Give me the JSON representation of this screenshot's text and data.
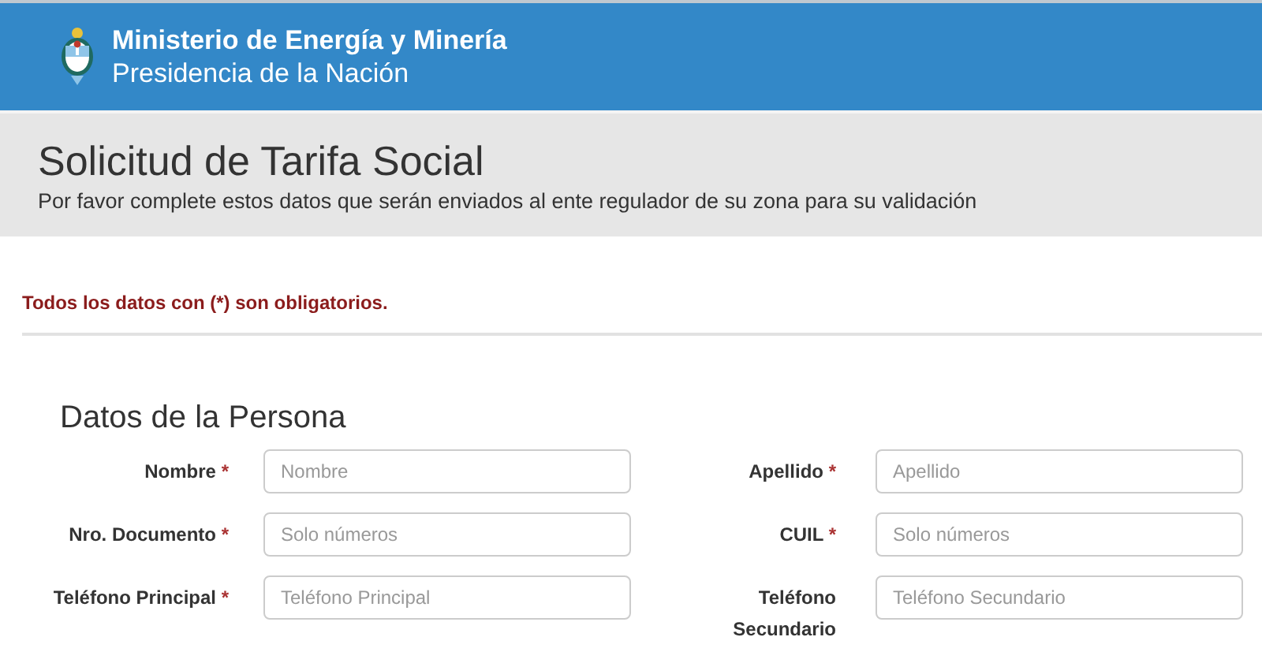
{
  "header": {
    "title": "Ministerio de Energía y Minería",
    "subtitle": "Presidencia de la Nación"
  },
  "banner": {
    "title": "Solicitud de Tarifa Social",
    "description": "Por favor complete estos datos que serán enviados al ente regulador de su zona para su validación"
  },
  "required_note": "Todos los datos con (*) son obligatorios.",
  "section": {
    "title": "Datos de la Persona",
    "fields": [
      {
        "label": "Nombre",
        "mark": "*",
        "placeholder": "Nombre"
      },
      {
        "label": "Apellido",
        "mark": "*",
        "placeholder": "Apellido"
      },
      {
        "label": "Nro. Documento",
        "mark": "*",
        "placeholder": "Solo números"
      },
      {
        "label": "CUIL",
        "mark": "*",
        "placeholder": "Solo números"
      },
      {
        "label": "Teléfono Principal",
        "mark": "*",
        "placeholder": "Teléfono Principal"
      },
      {
        "label": "Teléfono Secundario",
        "placeholder": "Teléfono Secundario"
      }
    ]
  }
}
